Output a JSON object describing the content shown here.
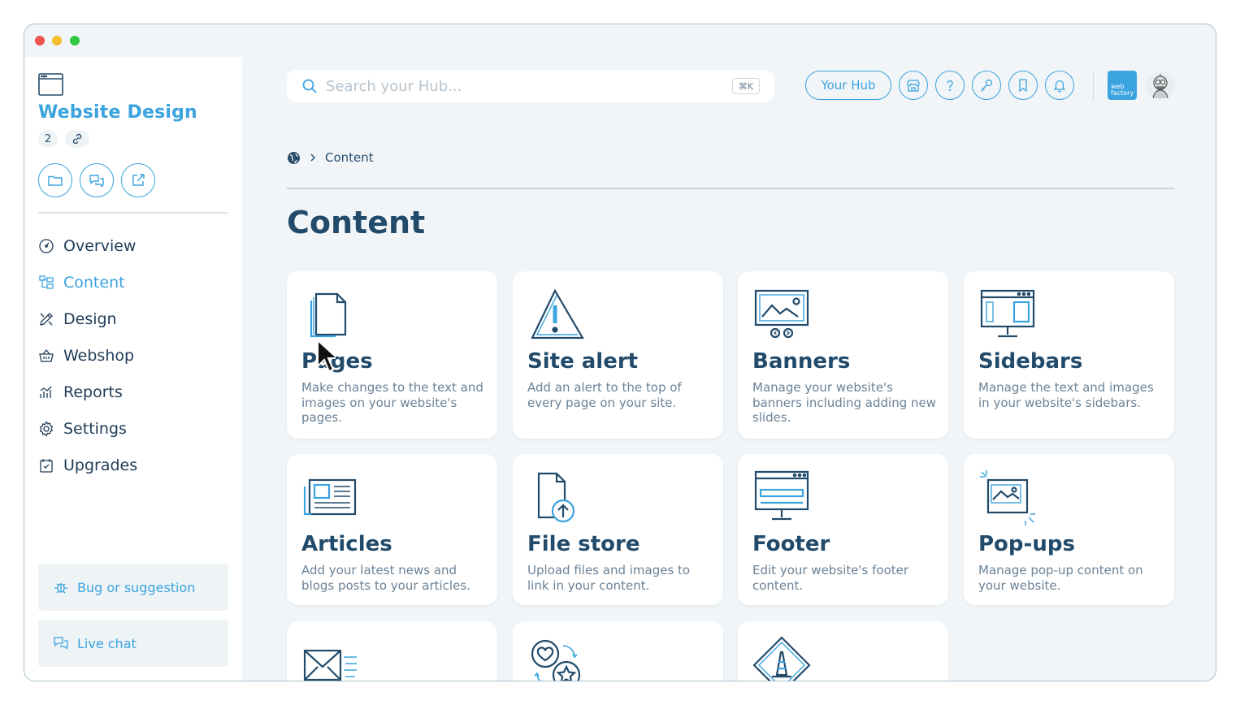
{
  "site": {
    "title": "Website Design",
    "count": "2"
  },
  "nav": [
    {
      "label": "Overview",
      "icon": "dashboard-icon"
    },
    {
      "label": "Content",
      "icon": "content-icon",
      "active": true
    },
    {
      "label": "Design",
      "icon": "design-icon"
    },
    {
      "label": "Webshop",
      "icon": "basket-icon"
    },
    {
      "label": "Reports",
      "icon": "chart-icon"
    },
    {
      "label": "Settings",
      "icon": "gear-icon"
    },
    {
      "label": "Upgrades",
      "icon": "upgrade-icon"
    }
  ],
  "sidebar_bottom": {
    "bug": "Bug or suggestion",
    "chat": "Live chat"
  },
  "header": {
    "search_placeholder": "Search your Hub...",
    "shortcut": "⌘K",
    "hub_button": "Your Hub",
    "logo_text_1": "web",
    "logo_text_2": "factory"
  },
  "breadcrumb": {
    "current": "Content"
  },
  "page": {
    "title": "Content"
  },
  "cards": [
    {
      "title": "Pages",
      "desc": "Make changes to the text and images on your website's pages.",
      "icon": "pages-icon"
    },
    {
      "title": "Site alert",
      "desc": "Add an alert to the top of every page on your site.",
      "icon": "alert-icon"
    },
    {
      "title": "Banners",
      "desc": "Manage your website's banners including adding new slides.",
      "icon": "banner-icon"
    },
    {
      "title": "Sidebars",
      "desc": "Manage the text and images in your website's sidebars.",
      "icon": "sidebar-icon"
    },
    {
      "title": "Articles",
      "desc": "Add your latest news and blogs posts to your articles.",
      "icon": "article-icon"
    },
    {
      "title": "File store",
      "desc": "Upload files and images to link in your content.",
      "icon": "file-upload-icon"
    },
    {
      "title": "Footer",
      "desc": "Edit your website's footer content.",
      "icon": "footer-icon"
    },
    {
      "title": "Pop-ups",
      "desc": "Manage pop-up content on your website.",
      "icon": "popup-icon"
    }
  ],
  "colors": {
    "accent": "#3ba3df",
    "heading": "#224b6b",
    "text": "#1f3c57",
    "muted": "#6a8297",
    "background": "#f1f5f8"
  }
}
